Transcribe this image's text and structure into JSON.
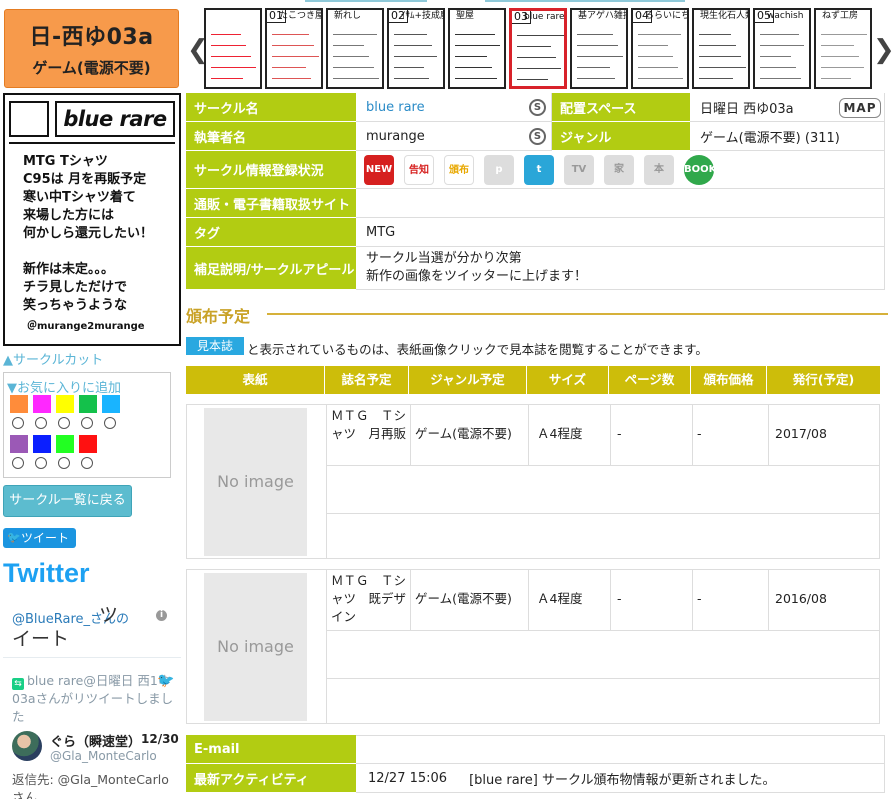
{
  "booth": {
    "code": "日-西ゆ03a",
    "genre": "ゲーム(電源不要)"
  },
  "circle_cut": {
    "name": "blue rare",
    "text": "MTG Tシャツ\nC95は 月を再販予定\n寒い中Tシャツ着て\n来場した方には\n何かしら還元したい！\n\n新作は未定。。。\nチラ見しただけで\n笑っちゃうような",
    "sign": "＠murange2murange"
  },
  "cut_link": "▲サークルカット",
  "favorite": {
    "title": "▼お気に入りに追加",
    "colors_row1": [
      "#ff8c3a",
      "#ff28ff",
      "#ffff00",
      "#14c14b",
      "#19b4ff"
    ],
    "colors_row2": [
      "#9b59b6",
      "#0b1fff",
      "#22ff22",
      "#ff1111"
    ]
  },
  "back_button": "サークル一覧に戻る",
  "tweet_button": "ツイート",
  "twitter": {
    "logo": "Twitter",
    "handle": "@BlueRare_さんの",
    "handle_suffix": "ツ",
    "handle_suffix2": "イート",
    "info_icon": "i",
    "retweet_text": "blue rare@日曜日 西1ゆ03aさんがリツイートしました",
    "user_name": "ぐら（瞬速堂）",
    "user_date": "12/30",
    "user_handle": "@Gla_MonteCarlo",
    "reply": "返信先: @Gla_MonteCarloさん"
  },
  "thumbnails": [
    {
      "num": "",
      "label": "",
      "selected": false
    },
    {
      "num": "01",
      "label": "たこつき屋",
      "selected": false
    },
    {
      "num": "",
      "label": "新れし",
      "selected": false
    },
    {
      "num": "02",
      "label": "ｲｻﾑ+技成魔晶",
      "selected": false
    },
    {
      "num": "",
      "label": "聖屋",
      "selected": false
    },
    {
      "num": "03",
      "label": "blue rare",
      "selected": true
    },
    {
      "num": "",
      "label": "基アゲハ雑技屋",
      "selected": false
    },
    {
      "num": "04",
      "label": "ろらいにちゃん",
      "selected": false
    },
    {
      "num": "",
      "label": "現生化石人類",
      "selected": false
    },
    {
      "num": "05",
      "label": "wachish",
      "selected": false
    },
    {
      "num": "",
      "label": "ねず工房",
      "selected": false
    }
  ],
  "info": {
    "circle_name_label": "サークル名",
    "circle_name": "blue rare",
    "space_label": "配置スペース",
    "space": "日曜日 西ゆ03a",
    "map_button": "MAP",
    "author_label": "執筆者名",
    "author": "murange",
    "genre_label": "ジャンル",
    "genre": "ゲーム(電源不要) (311)",
    "status_label": "サークル情報登録状況",
    "status_icons": [
      "NEW",
      "告知",
      "頒布",
      "p",
      "t",
      "TV",
      "家",
      "本",
      "BOOK"
    ],
    "shop_label": "通販・電子書籍取扱サイト",
    "shop": "",
    "tag_label": "タグ",
    "tag": "MTG",
    "appeal_label": "補足説明/サークルアピール",
    "appeal_line1": "サークル当選が分かり次第",
    "appeal_line2": "新作の画像をツイッターに上げます！"
  },
  "distribution": {
    "title": "頒布予定",
    "note_badge": "見本誌",
    "note_text": "と表示されているものは、表紙画像クリックで見本誌を閲覧することができます。",
    "headers": [
      "表紙",
      "誌名予定",
      "ジャンル予定",
      "サイズ",
      "ページ数",
      "頒布価格",
      "発行(予定)"
    ],
    "items": [
      {
        "cover": "No image",
        "title": "ＭＴＧ　Ｔシャツ　月再販",
        "genre": "ゲーム(電源不要)",
        "size": "Ａ4程度",
        "pages": "-",
        "price": "-",
        "date": "2017/08"
      },
      {
        "cover": "No image",
        "title": "ＭＴＧ　Ｔシャツ　既デザイン",
        "genre": "ゲーム(電源不要)",
        "size": "Ａ4程度",
        "pages": "-",
        "price": "-",
        "date": "2016/08"
      }
    ]
  },
  "bottom": {
    "email_label": "E-mail",
    "email": "",
    "activity_label": "最新アクティビティ",
    "activity_time": "12/27 15:06",
    "activity_text": "[blue rare] サークル頒布物情報が更新されました。"
  }
}
